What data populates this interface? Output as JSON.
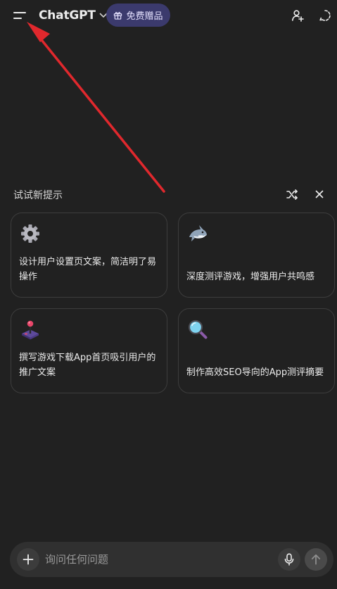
{
  "header": {
    "model_name": "ChatGPT",
    "gift_label": "免费赠品"
  },
  "suggestions": {
    "title": "试试新提示",
    "cards": [
      {
        "icon": "gear-icon",
        "text": "设计用户设置页文案，简洁明了易操作"
      },
      {
        "icon": "shark-icon",
        "text": "深度测评游戏，增强用户共鸣感"
      },
      {
        "icon": "joystick-icon",
        "text": "撰写游戏下载App首页吸引用户的推广文案"
      },
      {
        "icon": "magnifier-icon",
        "text": "制作高效SEO导向的App测评摘要"
      }
    ]
  },
  "composer": {
    "placeholder": "询问任何问题"
  },
  "colors": {
    "background": "#212121",
    "gift_pill": "#3b3a6d",
    "composer": "#303030",
    "annotation_arrow": "#e0282d"
  }
}
